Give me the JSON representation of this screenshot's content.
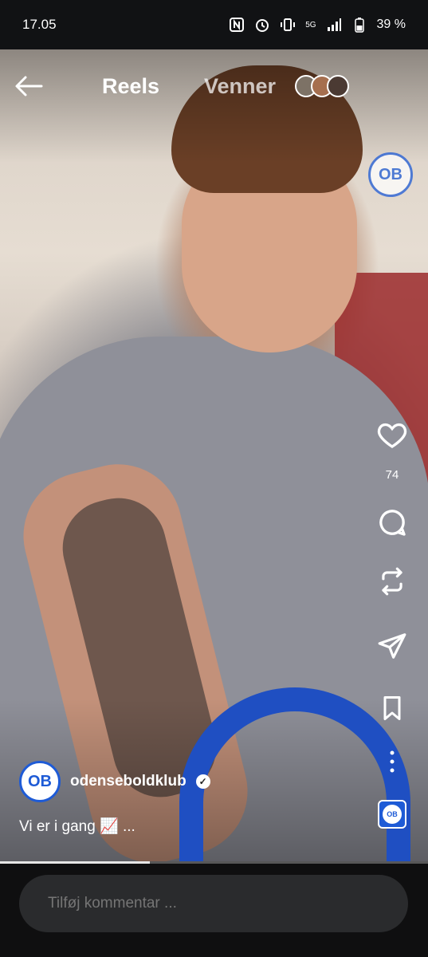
{
  "status_bar": {
    "time": "17.05",
    "network": "5G",
    "battery": "39 %"
  },
  "nav": {
    "reels_label": "Reels",
    "friends_label": "Venner"
  },
  "profile_badge": {
    "text": "OB"
  },
  "actions": {
    "like_count": "74"
  },
  "author": {
    "username": "odenseboldklub",
    "logo_text": "OB"
  },
  "caption": {
    "text": "Vi er i gang 📈 ..."
  },
  "progress": {
    "fraction": 0.35
  },
  "comment": {
    "placeholder": "Tilføj kommentar ..."
  },
  "colors": {
    "accent": "#1e5bd6",
    "background": "#0f0f10"
  }
}
